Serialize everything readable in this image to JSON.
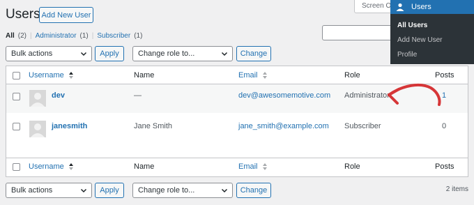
{
  "header": {
    "title": "Users",
    "add_new_label": "Add New User",
    "screen_options_label": "Screen Options"
  },
  "views": [
    {
      "label": "All",
      "count": "(2)"
    },
    {
      "label": "Administrator",
      "count": "(1)"
    },
    {
      "label": "Subscriber",
      "count": "(1)"
    }
  ],
  "bulk": {
    "label": "Bulk actions",
    "apply_label": "Apply",
    "role_label": "Change role to...",
    "change_label": "Change"
  },
  "table": {
    "columns": {
      "username": "Username",
      "name": "Name",
      "email": "Email",
      "role": "Role",
      "posts": "Posts"
    },
    "rows": [
      {
        "username": "dev",
        "name": "—",
        "email": "dev@awesomemotive.com",
        "role": "Administrator",
        "posts": "1"
      },
      {
        "username": "janesmith",
        "name": "Jane Smith",
        "email": "jane_smith@example.com",
        "role": "Subscriber",
        "posts": "0"
      }
    ]
  },
  "footer": {
    "items_count": "2 items"
  },
  "menu": {
    "title": "Users",
    "items": [
      "All Users",
      "Add New User",
      "Profile"
    ]
  },
  "colors": {
    "accent": "#2271b1",
    "menu_bg": "#2c3338",
    "annotation": "#d63638"
  },
  "icons": [
    "user-icon",
    "sort-arrows-icon",
    "chevron-down-icon",
    "annotation-arrow-icon"
  ]
}
